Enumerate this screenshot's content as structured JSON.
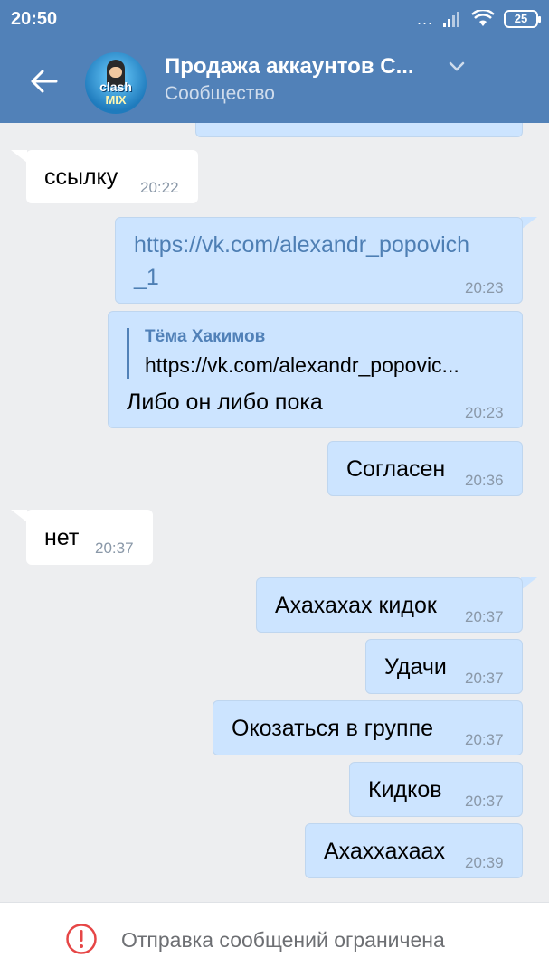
{
  "status_bar": {
    "time": "20:50",
    "dots": "...",
    "battery": "25"
  },
  "header": {
    "title": "Продажа аккаунтов С...",
    "subtitle": "Сообщество",
    "avatar_text_line1": "clash",
    "avatar_text_line2": "MIX"
  },
  "messages": [
    {
      "dir": "in",
      "text": "ссылку",
      "time": "20:22"
    },
    {
      "dir": "out",
      "line1": "https://vk.com/alexandr_popovich",
      "line2": "_1",
      "time": "20:23"
    },
    {
      "dir": "out",
      "reply_author": "Тёма Хакимов",
      "reply_text": "https://vk.com/alexandr_popovic...",
      "text": "Либо он либо пока",
      "time": "20:23"
    },
    {
      "dir": "out",
      "text": "Согласен",
      "time": "20:36"
    },
    {
      "dir": "in",
      "text": "нет",
      "time": "20:37"
    },
    {
      "dir": "out",
      "text": "Ахахахах кидок",
      "time": "20:37"
    },
    {
      "dir": "out",
      "text": "Удачи",
      "time": "20:37"
    },
    {
      "dir": "out",
      "text": "Окозаться в группе",
      "time": "20:37"
    },
    {
      "dir": "out",
      "text": "Кидков",
      "time": "20:37"
    },
    {
      "dir": "out",
      "text": "Ахаххахаах",
      "time": "20:39"
    }
  ],
  "footer": {
    "notice": "Отправка сообщений ограничена"
  },
  "colors": {
    "header": "#5181b8",
    "outgoing_bubble": "#cce4ff",
    "incoming_bubble": "#ffffff",
    "background": "#edeef0",
    "alert": "#e64646"
  }
}
